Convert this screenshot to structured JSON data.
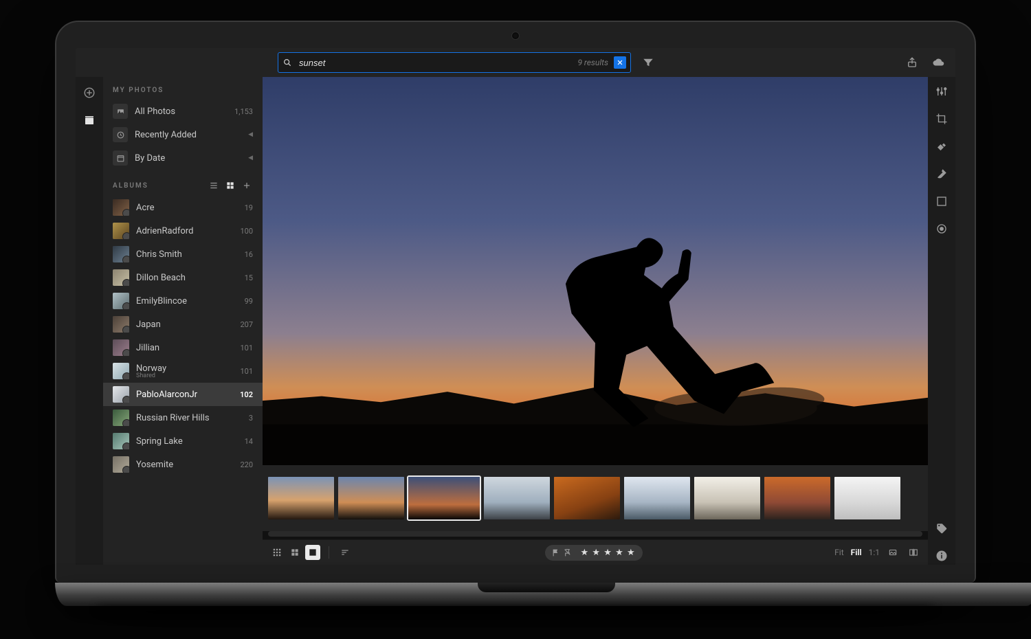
{
  "search": {
    "value": "sunset",
    "placeholder": "Search",
    "results_label": "9 results"
  },
  "sidebar": {
    "my_photos_title": "MY PHOTOS",
    "nav": [
      {
        "icon": "photos",
        "label": "All Photos",
        "meta": "1,153"
      },
      {
        "icon": "clock",
        "label": "Recently Added",
        "chev": true
      },
      {
        "icon": "calendar",
        "label": "By Date",
        "chev": true
      }
    ],
    "albums_title": "ALBUMS",
    "albums": [
      {
        "label": "Acre",
        "count": "19",
        "tg": "tg-acre"
      },
      {
        "label": "AdrienRadford",
        "count": "100",
        "tg": "tg-adrien"
      },
      {
        "label": "Chris Smith",
        "count": "16",
        "tg": "tg-chris"
      },
      {
        "label": "Dillon Beach",
        "count": "15",
        "tg": "tg-dillon"
      },
      {
        "label": "EmilyBlincoe",
        "count": "99",
        "tg": "tg-emily"
      },
      {
        "label": "Japan",
        "count": "207",
        "tg": "tg-japan"
      },
      {
        "label": "Jillian",
        "count": "101",
        "tg": "tg-jillian"
      },
      {
        "label": "Norway",
        "count": "101",
        "tg": "tg-norway",
        "sub": "Shared"
      },
      {
        "label": "PabloAlarconJr",
        "count": "102",
        "tg": "tg-pablo",
        "selected": true
      },
      {
        "label": "Russian River Hills",
        "count": "3",
        "tg": "tg-russian"
      },
      {
        "label": "Spring Lake",
        "count": "14",
        "tg": "tg-spring"
      },
      {
        "label": "Yosemite",
        "count": "220",
        "tg": "tg-yosemite"
      }
    ]
  },
  "filmstrip": {
    "items": [
      {
        "tg": "ft-1"
      },
      {
        "tg": "ft-2"
      },
      {
        "tg": "ft-3",
        "selected": true,
        "wide": true
      },
      {
        "tg": "ft-4"
      },
      {
        "tg": "ft-5"
      },
      {
        "tg": "ft-6"
      },
      {
        "tg": "ft-7"
      },
      {
        "tg": "ft-8"
      },
      {
        "tg": "ft-9"
      }
    ]
  },
  "zoom": {
    "fit": "Fit",
    "fill": "Fill",
    "one": "1:1",
    "active": "fill"
  },
  "rating": {
    "stars": 5
  }
}
